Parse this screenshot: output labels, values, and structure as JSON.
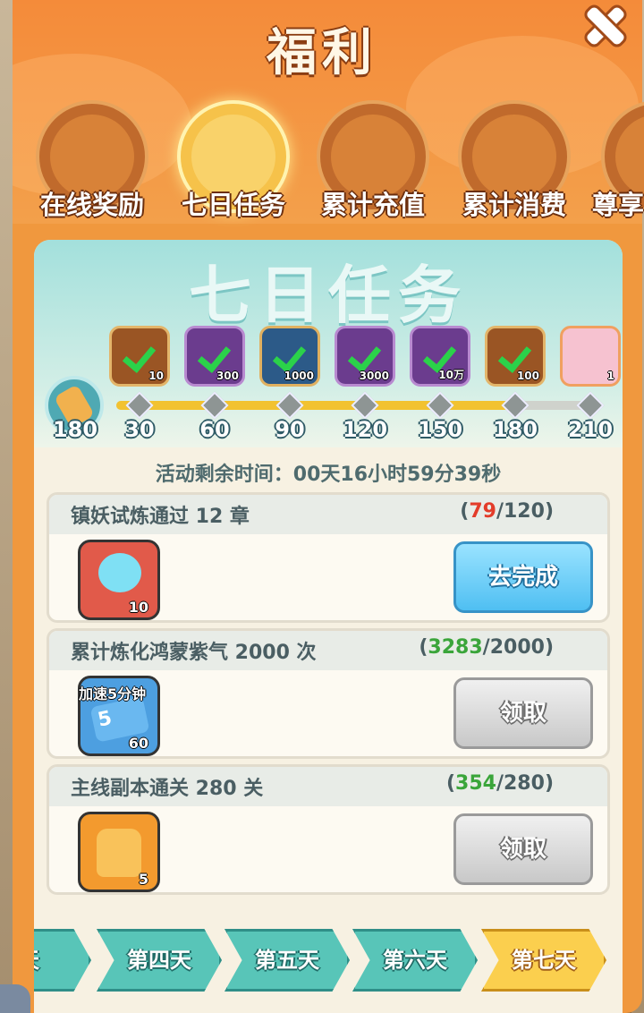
{
  "header": {
    "title": "福利",
    "close_icon": "close-icon"
  },
  "tabs": [
    {
      "label": "在线奖励",
      "icon": "stopwatch-icon",
      "active": false
    },
    {
      "label": "七日任务",
      "icon": "scroll-icon",
      "active": true
    },
    {
      "label": "累计充值",
      "icon": "gift-box-icon",
      "active": false
    },
    {
      "label": "累计消费",
      "icon": "purple-gift-icon",
      "active": false
    },
    {
      "label": "尊享",
      "icon": "crown-icon",
      "active": false
    }
  ],
  "banner": {
    "title": "七日任务"
  },
  "milestones": {
    "current_points": "180",
    "progress_fraction": 0.83,
    "points": [
      "30",
      "60",
      "90",
      "120",
      "150",
      "180",
      "210"
    ],
    "rewards": [
      {
        "count": "10",
        "claimed": true,
        "icon": "leaf-item-icon"
      },
      {
        "count": "300",
        "claimed": true,
        "icon": "purple-orb-icon"
      },
      {
        "count": "1000",
        "claimed": true,
        "icon": "blue-orb-icon"
      },
      {
        "count": "3000",
        "claimed": true,
        "icon": "green-sprout-icon"
      },
      {
        "count": "10万",
        "claimed": true,
        "icon": "green-grass-icon"
      },
      {
        "count": "100",
        "claimed": true,
        "icon": "chest-icon"
      },
      {
        "count": "1",
        "claimed": false,
        "icon": "pet-fox-icon"
      }
    ]
  },
  "timer": {
    "text": "活动剩余时间：00天16小时59分39秒"
  },
  "tasks": [
    {
      "name": "镇妖试炼通过 12 章",
      "current": "79",
      "target": "120",
      "status_color": "red",
      "reward_count": "10",
      "reward_icon": "blue-gem-chest-icon",
      "button": "去完成",
      "button_type": "go"
    },
    {
      "name": "累计炼化鸿蒙紫气 2000 次",
      "current": "3283",
      "target": "2000",
      "status_color": "green",
      "reward_count": "60",
      "reward_icon": "speedup-ticket-icon",
      "reward_tag": "加速5分钟",
      "ticket_number": "5",
      "button": "领取",
      "button_type": "claim"
    },
    {
      "name": "主线副本通关 280 关",
      "current": "354",
      "target": "280",
      "status_color": "green",
      "reward_count": "5",
      "reward_icon": "talisman-icon",
      "button": "领取",
      "button_type": "claim"
    }
  ],
  "days": [
    "天",
    "第四天",
    "第五天",
    "第六天",
    "第七天"
  ],
  "active_day": "第七天",
  "colors": {
    "header": "#f48b3a",
    "accent_green": "#3aa53a",
    "accent_red": "#e33c2a",
    "day_tab": "#58c5b8",
    "day_tab_active": "#fbcf4e"
  }
}
